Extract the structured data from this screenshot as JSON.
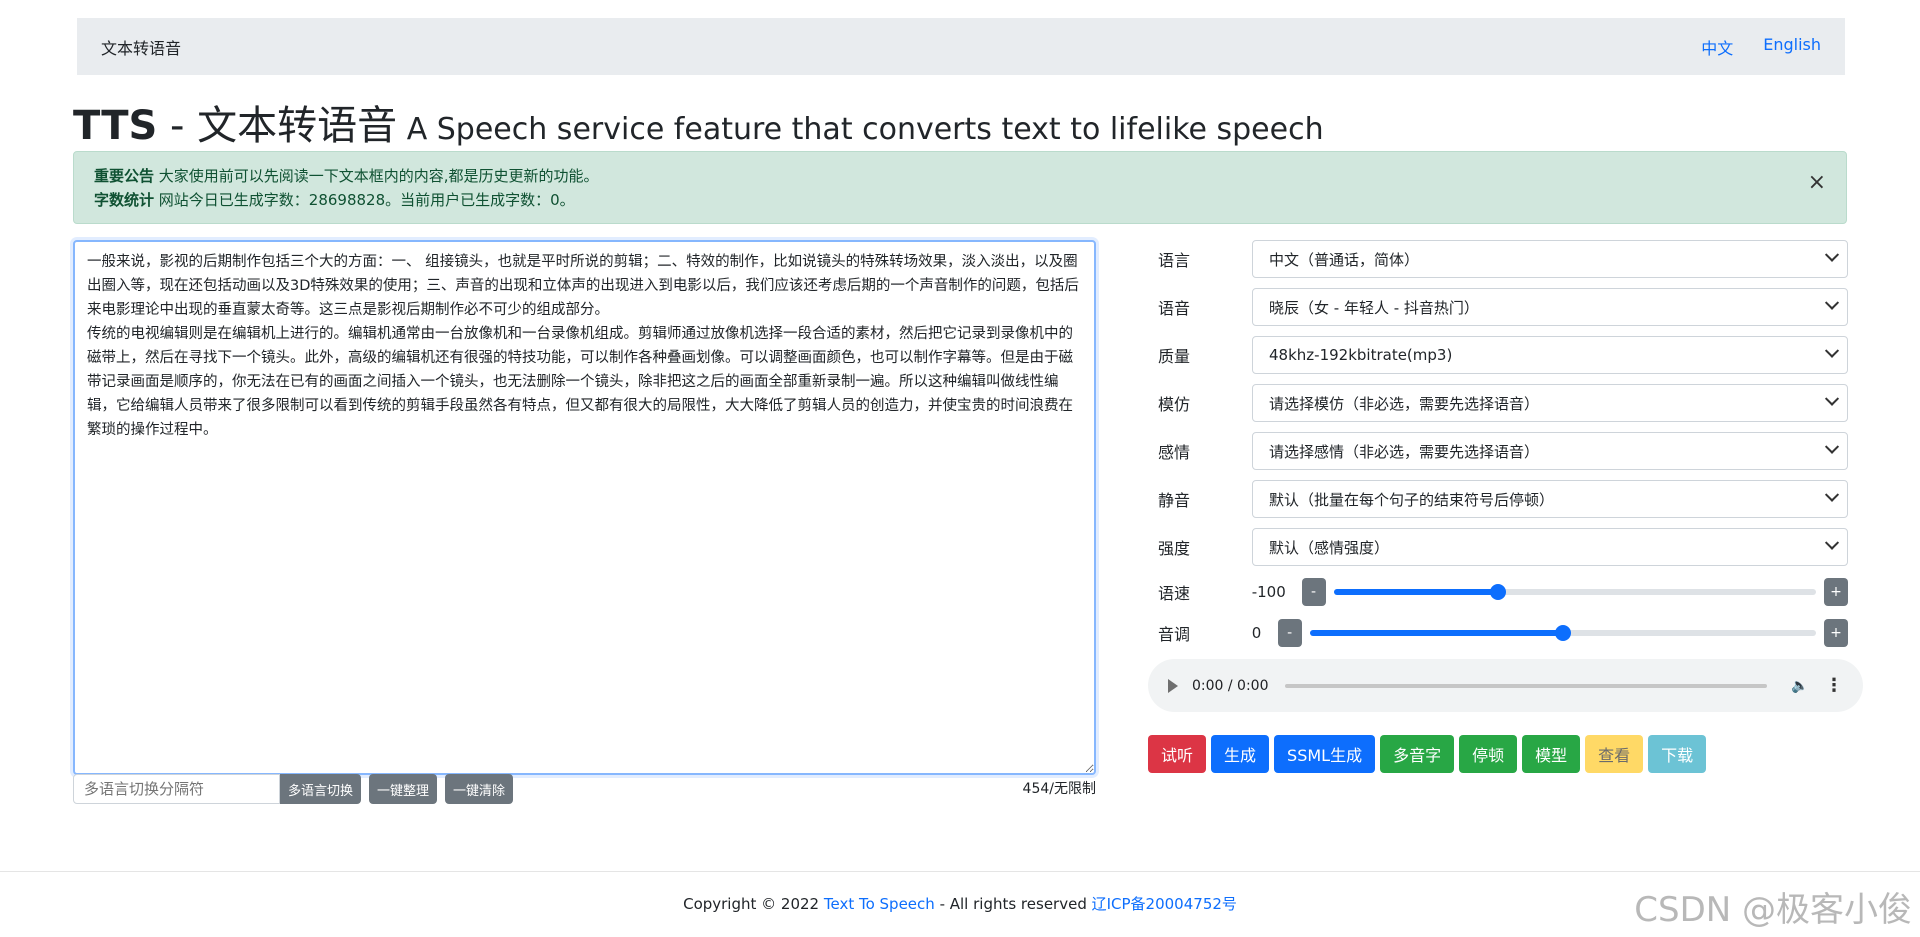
{
  "navbar": {
    "brand": "文本转语音",
    "links": [
      "中文",
      "English"
    ]
  },
  "title": {
    "main": "TTS",
    "dash": " - ",
    "cn": "文本转语音",
    "sub": " A Speech service feature that converts text to lifelike speech"
  },
  "alert": {
    "line1_label": "重要公告",
    "line1_text": " 大家使用前可以先阅读一下文本框内的内容,都是历史更新的功能。",
    "line2_label": "字数统计",
    "line2_text": " 网站今日已生成字数：28698828。当前用户已生成字数：0。",
    "close": "×"
  },
  "editor": {
    "content": "一般来说，影视的后期制作包括三个大的方面：一、 组接镜头，也就是平时所说的剪辑；二、特效的制作，比如说镜头的特殊转场效果，淡入淡出，以及圈出圈入等，现在还包括动画以及3D特殊效果的使用；三、声音的出现和立体声的出现进入到电影以后，我们应该还考虑后期的一个声音制作的问题，包括后来电影理论中出现的垂直蒙太奇等。这三点是影视后期制作必不可少的组成部分。\n传统的电视编辑则是在编辑机上进行的。编辑机通常由一台放像机和一台录像机组成。剪辑师通过放像机选择一段合适的素材，然后把它记录到录像机中的磁带上，然后在寻找下一个镜头。此外，高级的编辑机还有很强的特技功能，可以制作各种叠画划像。可以调整画面颜色，也可以制作字幕等。但是由于磁带记录画面是顺序的，你无法在已有的画面之间插入一个镜头，也无法删除一个镜头，除非把这之后的画面全部重新录制一遍。所以这种编辑叫做线性编辑，它给编辑人员带来了很多限制可以看到传统的剪辑手段虽然各有特点，但又都有很大的局限性，大大降低了剪辑人员的创造力，并使宝贵的时间浪费在繁琐的操作过程中。"
  },
  "under_bar": {
    "separator_placeholder": "多语言切换分隔符",
    "btn_switch": "多语言切换",
    "btn_tidy": "一键整理",
    "btn_clear": "一键清除",
    "count": "454/无限制"
  },
  "settings": {
    "language": {
      "label": "语言",
      "value": "中文（普通话，简体）"
    },
    "voice": {
      "label": "语音",
      "value": "晓辰（女 - 年轻人 - 抖音热门）"
    },
    "quality": {
      "label": "质量",
      "value": "48khz-192kbitrate(mp3)"
    },
    "imitate": {
      "label": "模仿",
      "value": "请选择模仿（非必选，需要先选择语音）"
    },
    "emotion": {
      "label": "感情",
      "value": "请选择感情（非必选，需要先选择语音）"
    },
    "silence": {
      "label": "静音",
      "value": "默认（批量在每个句子的结束符号后停顿）"
    },
    "intensity": {
      "label": "强度",
      "value": "默认（感情强度）"
    },
    "speed": {
      "label": "语速",
      "value": "-100",
      "minus": "-",
      "plus": "+",
      "level": 0.34
    },
    "pitch": {
      "label": "音调",
      "value": "0",
      "minus": "-",
      "plus": "+",
      "level": 0.5
    }
  },
  "audio": {
    "time": "0:00 / 0:00"
  },
  "actions": [
    "试听",
    "生成",
    "SSML生成",
    "多音字",
    "停顿",
    "模型",
    "查看",
    "下载"
  ],
  "footer": {
    "copyright": "Copyright © 2022 ",
    "site_link": "Text To Speech",
    "rights": " - All rights reserved ",
    "icp_link": "辽ICP备20004752号"
  },
  "watermark": "CSDN @极客小俊"
}
